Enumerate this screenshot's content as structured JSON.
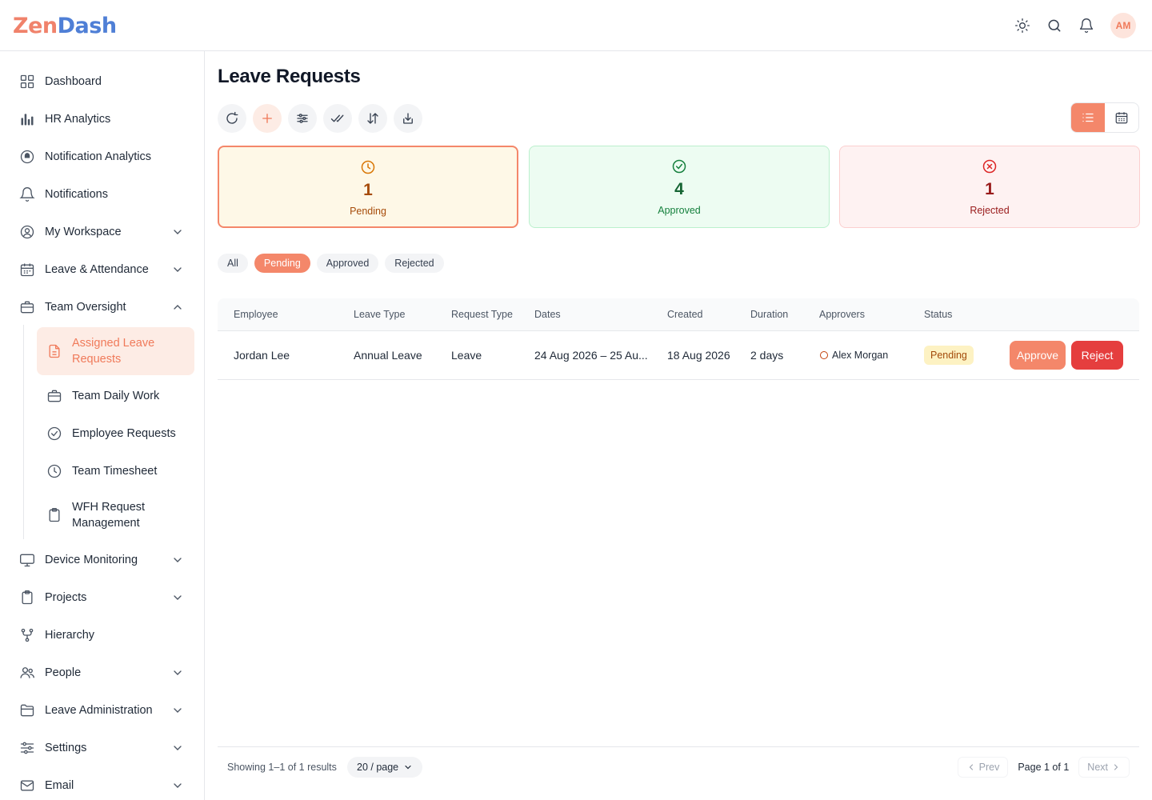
{
  "brand": {
    "name_part1": "Zen",
    "name_part2": "Dash"
  },
  "header": {
    "avatar_initials": "AM"
  },
  "sidebar": {
    "items": [
      {
        "label": "Dashboard",
        "icon": "grid-icon"
      },
      {
        "label": "HR Analytics",
        "icon": "bar-chart-icon"
      },
      {
        "label": "Notification Analytics",
        "icon": "analytics-icon"
      },
      {
        "label": "Notifications",
        "icon": "bell-icon"
      },
      {
        "label": "My Workspace",
        "icon": "user-circle-icon"
      },
      {
        "label": "Leave & Attendance",
        "icon": "calendar-icon"
      },
      {
        "label": "Team Oversight",
        "icon": "briefcase-icon"
      },
      {
        "label": "Device Monitoring",
        "icon": "monitor-icon"
      },
      {
        "label": "Projects",
        "icon": "clipboard-icon"
      },
      {
        "label": "Hierarchy",
        "icon": "git-fork-icon"
      },
      {
        "label": "People",
        "icon": "users-icon"
      },
      {
        "label": "Leave Administration",
        "icon": "folder-icon"
      },
      {
        "label": "Settings",
        "icon": "sliders-icon"
      },
      {
        "label": "Email",
        "icon": "mail-icon"
      }
    ],
    "subitems": [
      {
        "label": "Assigned Leave Requests"
      },
      {
        "label": "Team Daily Work"
      },
      {
        "label": "Employee Requests"
      },
      {
        "label": "Team Timesheet"
      },
      {
        "label": "WFH Request Management"
      }
    ]
  },
  "main": {
    "title": "Leave Requests",
    "stats": [
      {
        "value": "1",
        "label": "Pending"
      },
      {
        "value": "4",
        "label": "Approved"
      },
      {
        "value": "1",
        "label": "Rejected"
      }
    ],
    "filters": [
      "All",
      "Pending",
      "Approved",
      "Rejected"
    ],
    "active_filter": "Pending",
    "table": {
      "columns": [
        "Employee",
        "Leave Type",
        "Request Type",
        "Dates",
        "Created",
        "Duration",
        "Approvers",
        "Status"
      ],
      "rows": [
        {
          "employee": "Jordan Lee",
          "leave_type": "Annual Leave",
          "request_type": "Leave",
          "dates": "24 Aug 2026 – 25 Au...",
          "created": "18 Aug 2026",
          "duration": "2 days",
          "approver": "Alex Morgan",
          "status": "Pending",
          "approve_label": "Approve",
          "reject_label": "Reject"
        }
      ]
    },
    "footer": {
      "showing": "Showing 1–1 of 1 results",
      "per_page": "20 / page",
      "prev": "Prev",
      "page": "Page 1 of 1",
      "next": "Next"
    }
  },
  "colors": {
    "accent": "#f4876a",
    "danger": "#e53e3e",
    "pending_bg": "#fef8e7",
    "approved_bg": "#edfcf2",
    "rejected_bg": "#fef2f2"
  }
}
